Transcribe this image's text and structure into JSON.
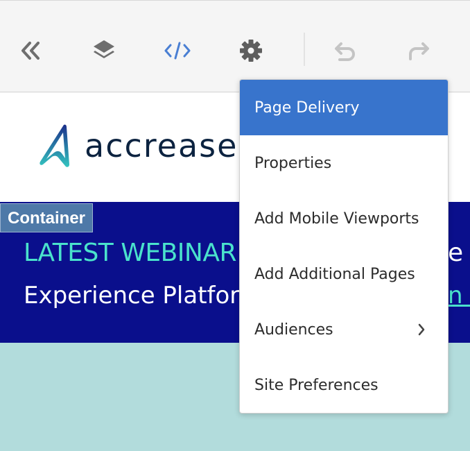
{
  "toolbar": {
    "buttons": [
      {
        "name": "collapse-double-chevron-icon"
      },
      {
        "name": "layers-icon"
      },
      {
        "name": "code-icon"
      },
      {
        "name": "gear-icon"
      },
      {
        "name": "undo-icon"
      },
      {
        "name": "redo-icon"
      }
    ]
  },
  "page": {
    "logo_text": "accrease",
    "container_label": "Container",
    "banner_title": "LATEST WEBINAR",
    "banner_subtitle": "Experience Platform",
    "banner_title_tail": "e (",
    "banner_link_tail": "n >"
  },
  "menu": {
    "items": [
      {
        "label": "Page Delivery",
        "selected": true
      },
      {
        "label": "Properties"
      },
      {
        "label": "Add Mobile Viewports"
      },
      {
        "label": "Add Additional Pages"
      },
      {
        "label": "Audiences",
        "has_submenu": true
      },
      {
        "label": "Site Preferences"
      }
    ]
  },
  "colors": {
    "accent_blue": "#3874cc",
    "banner_navy": "#0a0f8c",
    "teal_text": "#4ae2cc",
    "code_icon_blue": "#4a7fd3"
  }
}
